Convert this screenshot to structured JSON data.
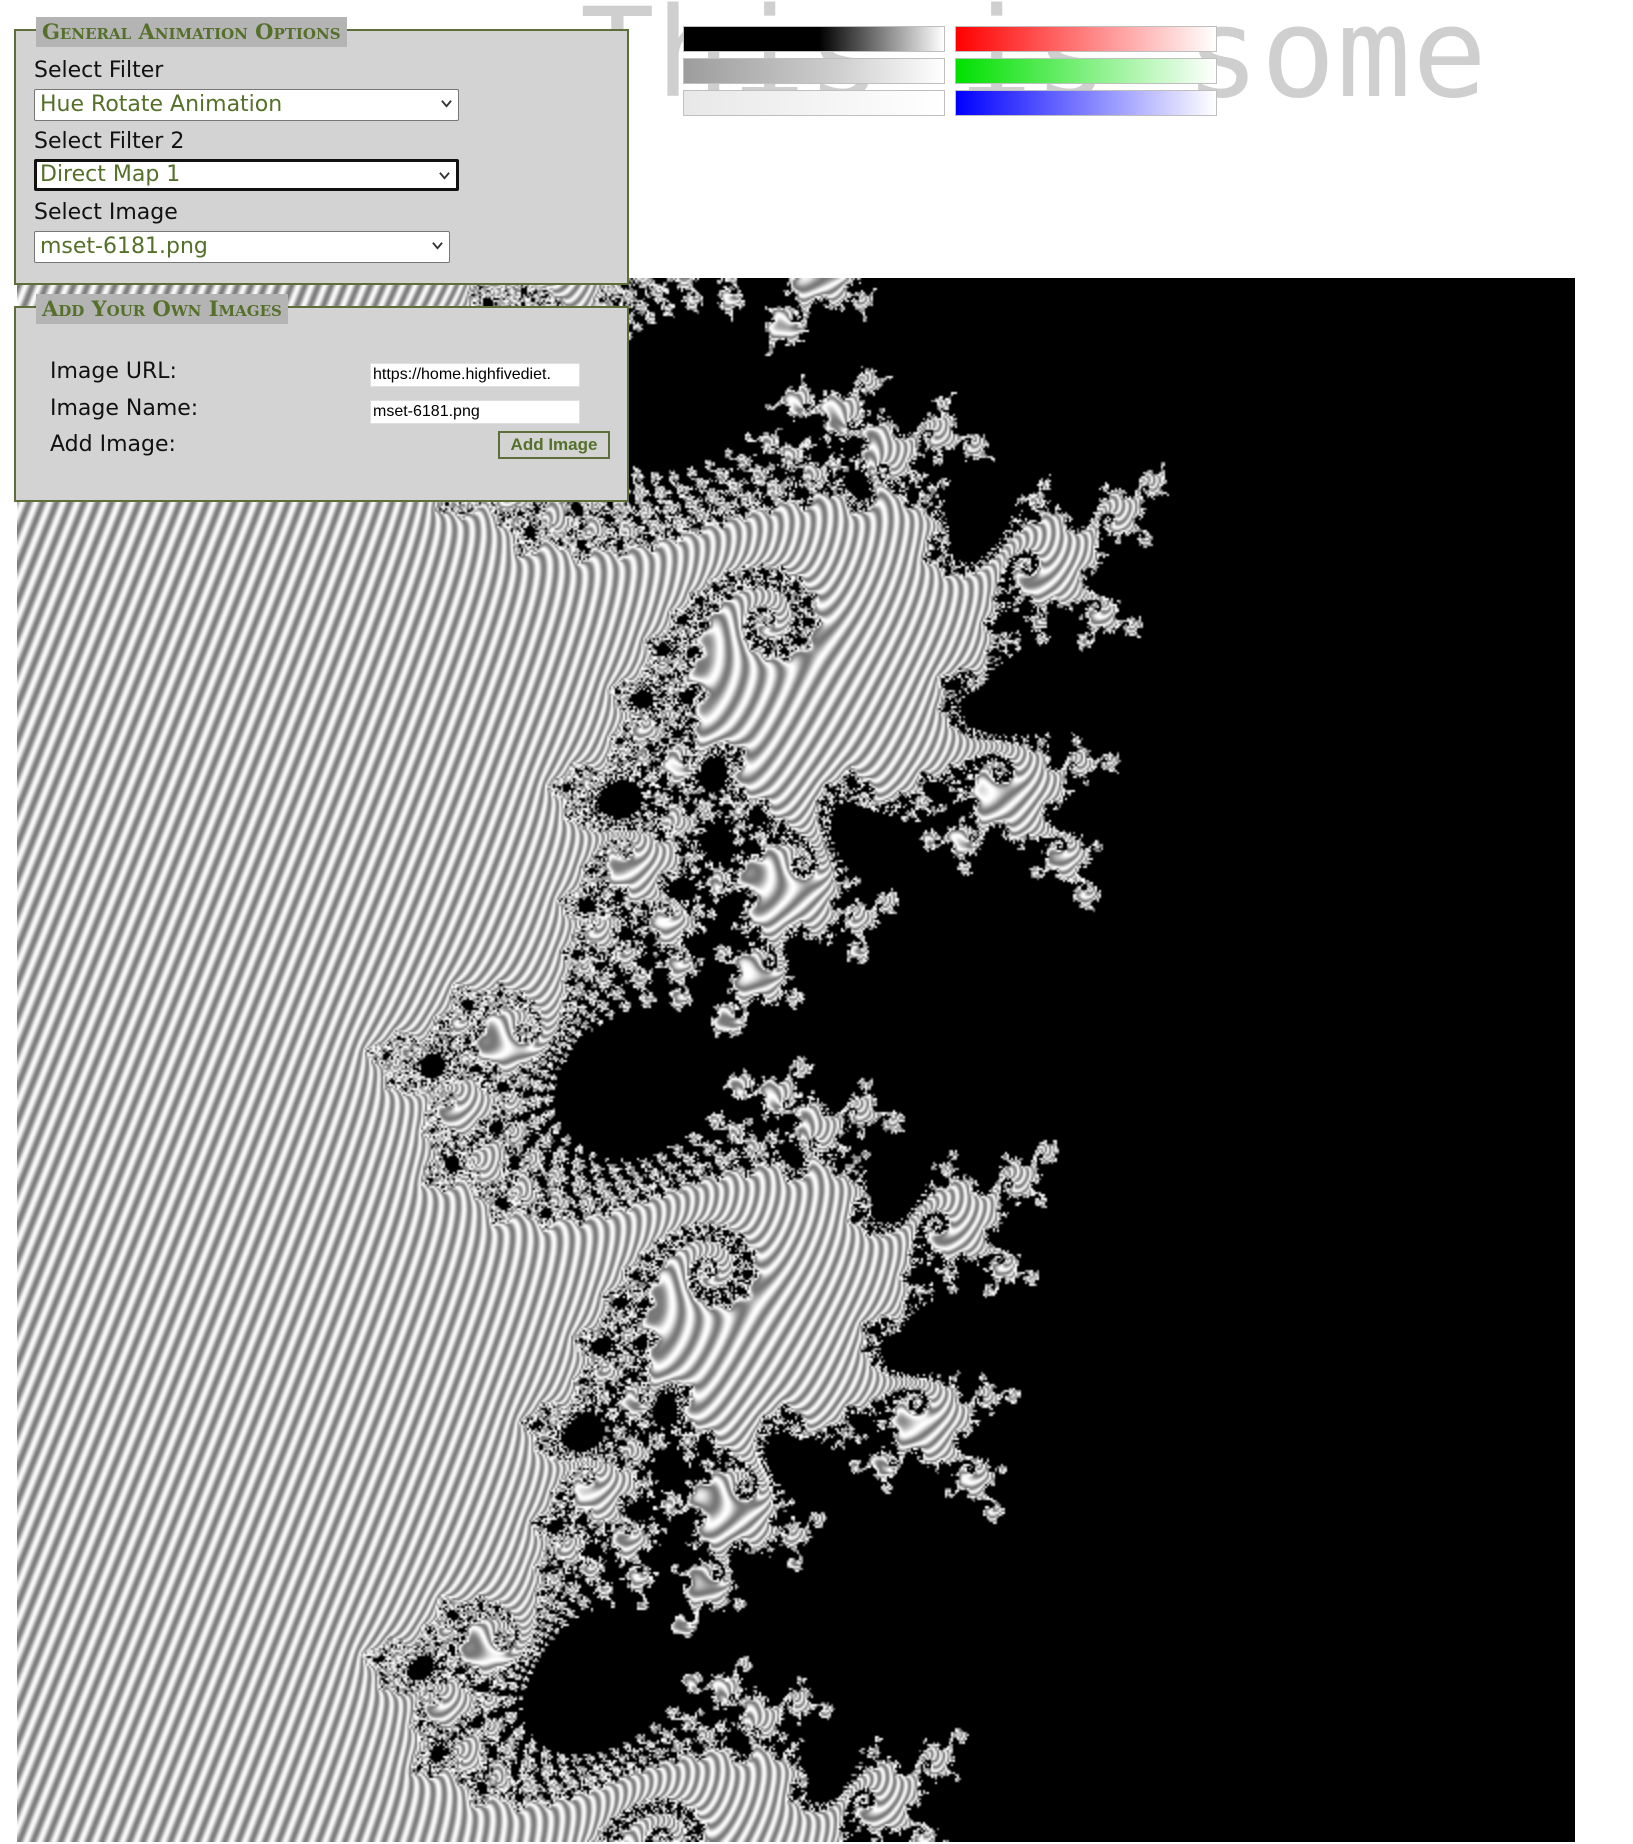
{
  "background_text": "This is some",
  "general_options": {
    "legend": "General Animation Options",
    "filter_label": "Select Filter",
    "filter_value": "Hue Rotate Animation",
    "filter2_label": "Select Filter 2",
    "filter2_value": "Direct Map 1",
    "image_label": "Select Image",
    "image_value": "mset-6181.png"
  },
  "add_images": {
    "legend": "Add Your Own Images",
    "url_label": "Image URL:",
    "url_value": "https://home.highfivediet.",
    "name_label": "Image Name:",
    "name_value": "mset-6181.png",
    "add_label": "Add Image:",
    "add_button": "Add Image"
  },
  "colors": {
    "accent": "#55702a",
    "panel_bg": "#d3d3d3",
    "legend_bg": "#b4b4b4"
  },
  "swatches": [
    "black-to-white",
    "gray-to-white",
    "light-gray-to-white",
    "red-to-white",
    "green-to-white",
    "blue-to-white"
  ],
  "fractal": {
    "description_icon": "mandelbrot-image"
  }
}
